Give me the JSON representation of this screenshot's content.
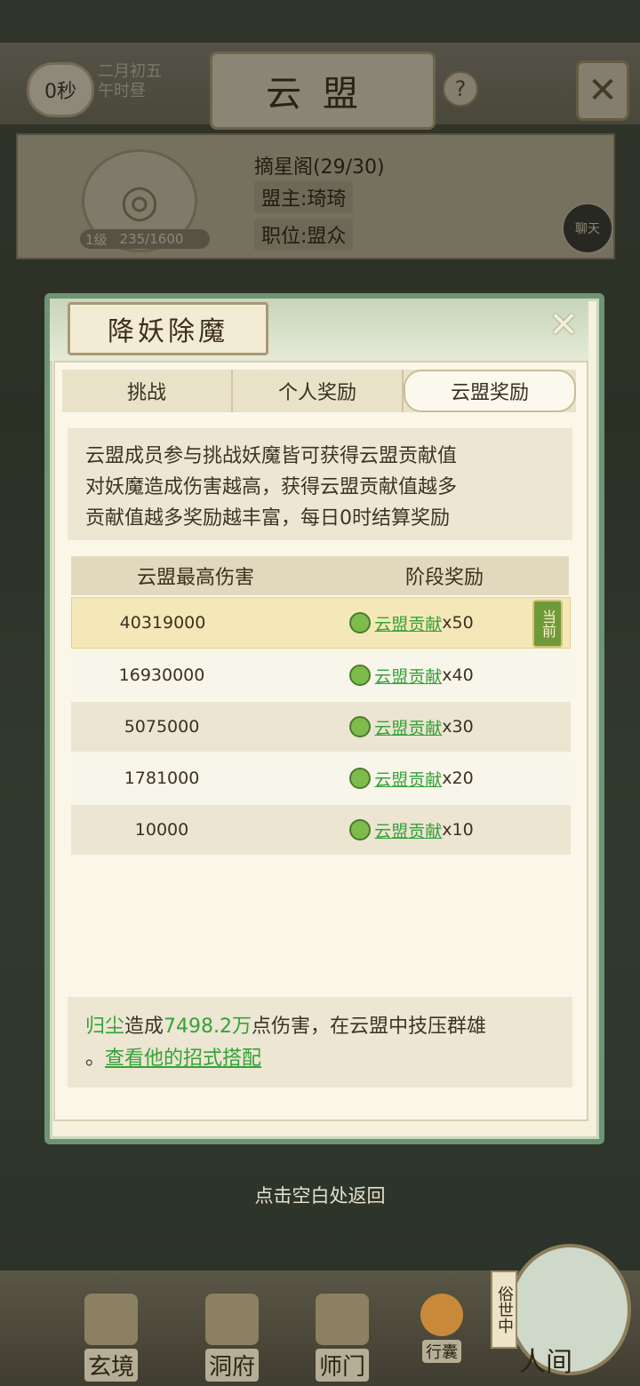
{
  "header": {
    "timer": "0秒",
    "date_line1": "二月初五",
    "date_line2": "午时昼",
    "title": "云盟",
    "help": "?",
    "close": "✕"
  },
  "guild": {
    "name": "摘星阁(29/30)",
    "leader": "盟主:琦琦",
    "position": "职位:盟众",
    "level": "1级",
    "exp": "235/1600",
    "chat": "聊天"
  },
  "modal": {
    "title": "降妖除魔",
    "close": "✕",
    "tabs": [
      {
        "label": "挑战",
        "active": false
      },
      {
        "label": "个人奖励",
        "active": false
      },
      {
        "label": "云盟奖励",
        "active": true
      }
    ],
    "description": [
      "云盟成员参与挑战妖魔皆可获得云盟贡献值",
      "对妖魔造成伤害越高，获得云盟贡献值越多",
      "贡献值越多奖励越丰富，每日0时结算奖励"
    ],
    "table": {
      "headers": [
        "云盟最高伤害",
        "阶段奖励"
      ],
      "rows": [
        {
          "damage": "40319000",
          "reward": "云盟贡献",
          "count": "x50",
          "current": true
        },
        {
          "damage": "16930000",
          "reward": "云盟贡献",
          "count": "x40",
          "current": false
        },
        {
          "damage": "5075000",
          "reward": "云盟贡献",
          "count": "x30",
          "current": false
        },
        {
          "damage": "1781000",
          "reward": "云盟贡献",
          "count": "x20",
          "current": false
        },
        {
          "damage": "10000",
          "reward": "云盟贡献",
          "count": "x10",
          "current": false
        }
      ],
      "current_badge": "当前"
    },
    "note": {
      "player": "归尘",
      "text1": "造成",
      "damage": "7498.2万",
      "text2": "点伤害，在云盟中技压群雄",
      "text3": "。",
      "link": "查看他的招式搭配"
    }
  },
  "back_tip": "点击空白处返回",
  "bottom_nav": {
    "items": [
      "玄境",
      "洞府",
      "师门",
      "行囊"
    ],
    "world_tag": "俗世中",
    "world_label": "人间"
  },
  "colors": {
    "accent_green": "#36a13a",
    "frame_green": "#6e9473"
  }
}
